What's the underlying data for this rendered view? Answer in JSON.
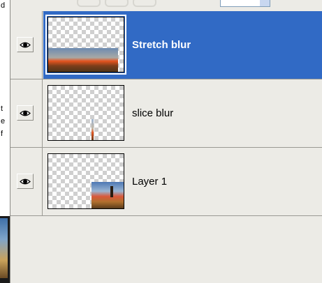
{
  "left_document": {
    "fragments": [
      "d",
      "t",
      "e",
      "f"
    ]
  },
  "layers_panel": {
    "layers": [
      {
        "name": "Stretch blur",
        "visible": true,
        "selected": true
      },
      {
        "name": "slice blur",
        "visible": true,
        "selected": false
      },
      {
        "name": "Layer 1",
        "visible": true,
        "selected": false
      }
    ]
  },
  "colors": {
    "selection": "#316ac5",
    "panel_bg": "#ecebe6",
    "divider": "#9a9993"
  },
  "icons": {
    "visibility": "eye-icon"
  }
}
